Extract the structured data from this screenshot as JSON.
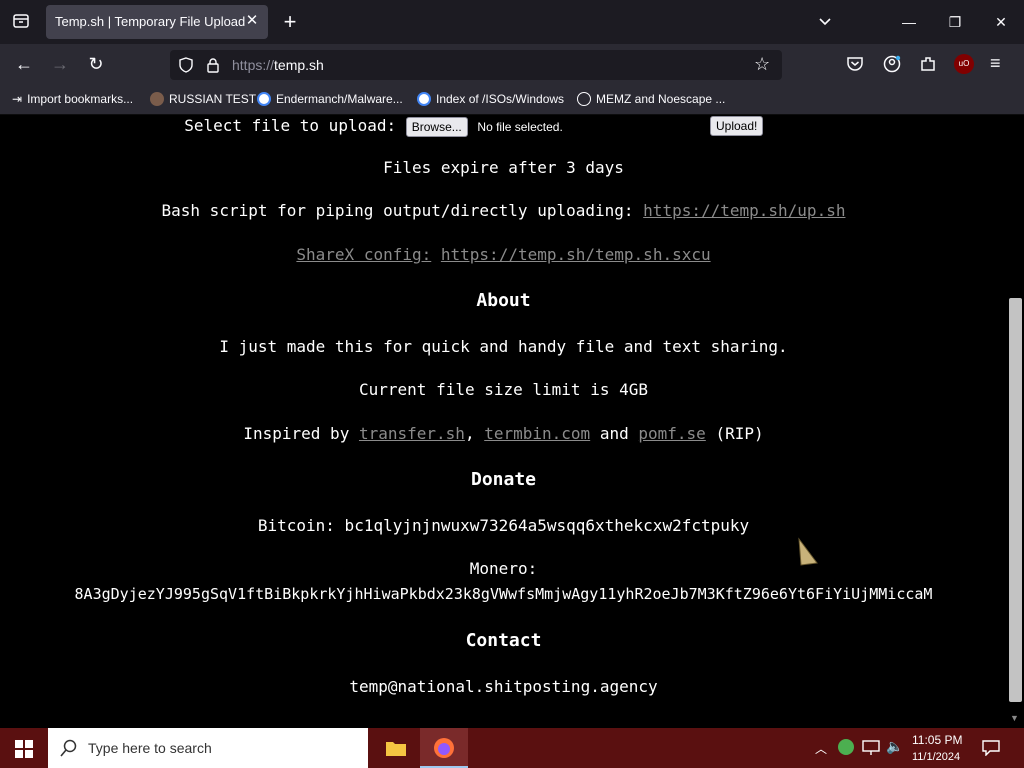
{
  "browser": {
    "tab_title": "Temp.sh | Temporary File Upload",
    "url_proto": "https://",
    "url_host": "temp.sh",
    "bookmarks": [
      {
        "label": "Import bookmarks...",
        "icon": "import-icon"
      },
      {
        "label": "RUSSIAN TEST",
        "icon": "site-icon"
      },
      {
        "label": "Endermanch/Malware...",
        "icon": "google-icon"
      },
      {
        "label": "Index of /ISOs/Windows",
        "icon": "google-icon"
      },
      {
        "label": "MEMZ and Noescape ...",
        "icon": "globe-icon"
      }
    ]
  },
  "page": {
    "select_label": "Select file to upload:",
    "browse_label": "Browse...",
    "no_file": "No file selected.",
    "upload_label": "Upload!",
    "expire": "Files expire after 3 days",
    "bash_prefix": "Bash script for piping output/directly uploading:",
    "bash_link": "https://temp.sh/up.sh",
    "sharex_label": "ShareX config:",
    "sharex_link": "https://temp.sh/temp.sh.sxcu",
    "about_heading": "About",
    "about_text": "I just made this for quick and handy file and text sharing.",
    "size_limit": "Current file size limit is 4GB",
    "inspired_prefix": "Inspired by",
    "inspired_link1": "transfer.sh",
    "inspired_comma": ",",
    "inspired_link2": "termbin.com",
    "inspired_and": "and",
    "inspired_link3": "pomf.se",
    "inspired_suffix": "(RIP)",
    "donate_heading": "Donate",
    "bitcoin": "Bitcoin: bc1qlyjnjnwuxw73264a5wsqq6xthekcxw2fctpuky",
    "monero_label": "Monero:",
    "monero_addr": "8A3gDyjezYJ995gSqV1ftBiBkpkrkYjhHiwaPkbdx23k8gVWwfsMmjwAgy11yhR2oeJb7M3KftZ96e6Yt6FiYiUjMMiccaM",
    "contact_heading": "Contact",
    "contact_email": "temp@national.shitposting.agency"
  },
  "taskbar": {
    "search_placeholder": "Type here to search",
    "time": "11:05 PM",
    "date": "11/1/2024"
  }
}
